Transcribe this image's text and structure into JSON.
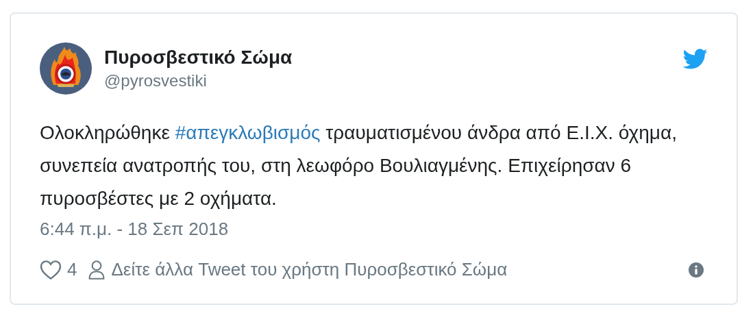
{
  "author": {
    "name": "Πυροσβεστικό Σώμα",
    "handle": "@pyrosvestiki"
  },
  "body": [
    {
      "kind": "text",
      "text": "Ολοκληρώθηκε "
    },
    {
      "kind": "hashtag",
      "text": "#απεγκλωβισμός"
    },
    {
      "kind": "text",
      "text": " τραυματισμένου άνδρα από Ε.Ι.Χ. όχημα, συνεπεία ανατροπής του, στη λεωφόρο Βουλιαγμένης. Επιχείρησαν 6 πυροσβέστες με 2 οχήματα."
    }
  ],
  "timestamp": "6:44 π.μ. - 18 Σεπ 2018",
  "footer": {
    "likes": "4",
    "profile_link": "Δείτε άλλα Tweet του χρήστη Πυροσβεστικό Σώμα"
  }
}
